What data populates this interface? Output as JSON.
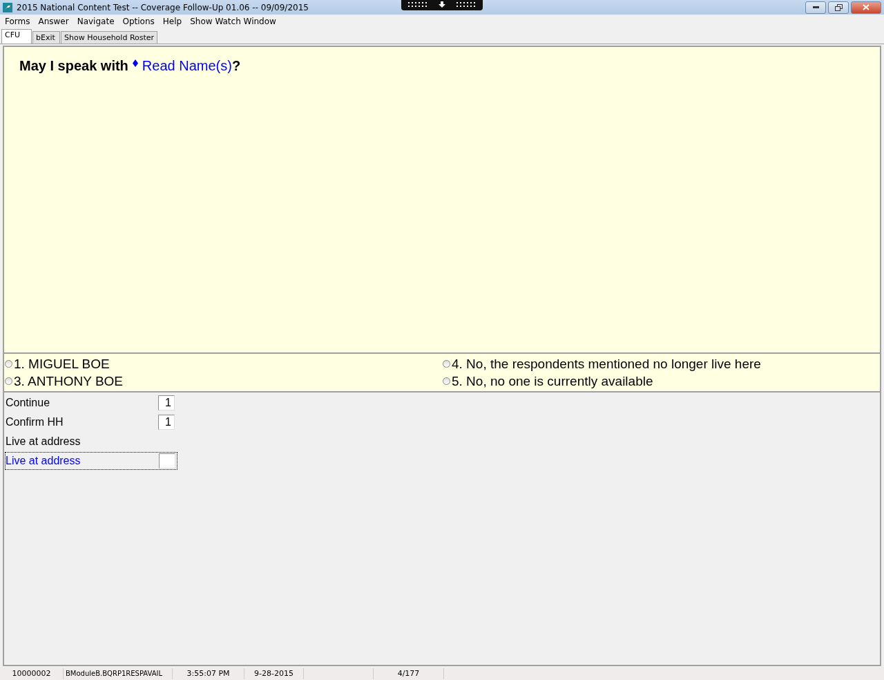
{
  "window": {
    "title": "2015 National Content Test -- Coverage Follow-Up 01.06 -- 09/09/2015"
  },
  "menu": [
    "Forms",
    "Answer",
    "Navigate",
    "Options",
    "Help",
    "Show Watch Window"
  ],
  "tabs": [
    {
      "label": "CFU",
      "selected": true
    },
    {
      "label": "bExit",
      "selected": false
    },
    {
      "label": "Show Household Roster",
      "selected": false
    }
  ],
  "question": {
    "lead": "May I speak with",
    "fill": "Read Name(s)",
    "end": "?"
  },
  "answers": [
    {
      "label": "1. MIGUEL BOE",
      "selected": false
    },
    {
      "label": "4. No, the respondents mentioned no longer live here",
      "selected": false
    },
    {
      "label": "3. ANTHONY BOE",
      "selected": false
    },
    {
      "label": "5. No, no one is currently available",
      "selected": false
    }
  ],
  "fields": [
    {
      "kind": "field",
      "label": "Continue",
      "value": "1",
      "current": false
    },
    {
      "kind": "field",
      "label": "Confirm HH",
      "value": "1",
      "current": false
    },
    {
      "kind": "label",
      "label": "Live at address"
    },
    {
      "kind": "field",
      "label": "Live at address",
      "current": true
    }
  ],
  "status_bar": [
    "10000002",
    "BModuleB.BQRP1RESPAVAIL",
    "3:55:07 PM",
    "9-28-2015",
    "4/177"
  ]
}
